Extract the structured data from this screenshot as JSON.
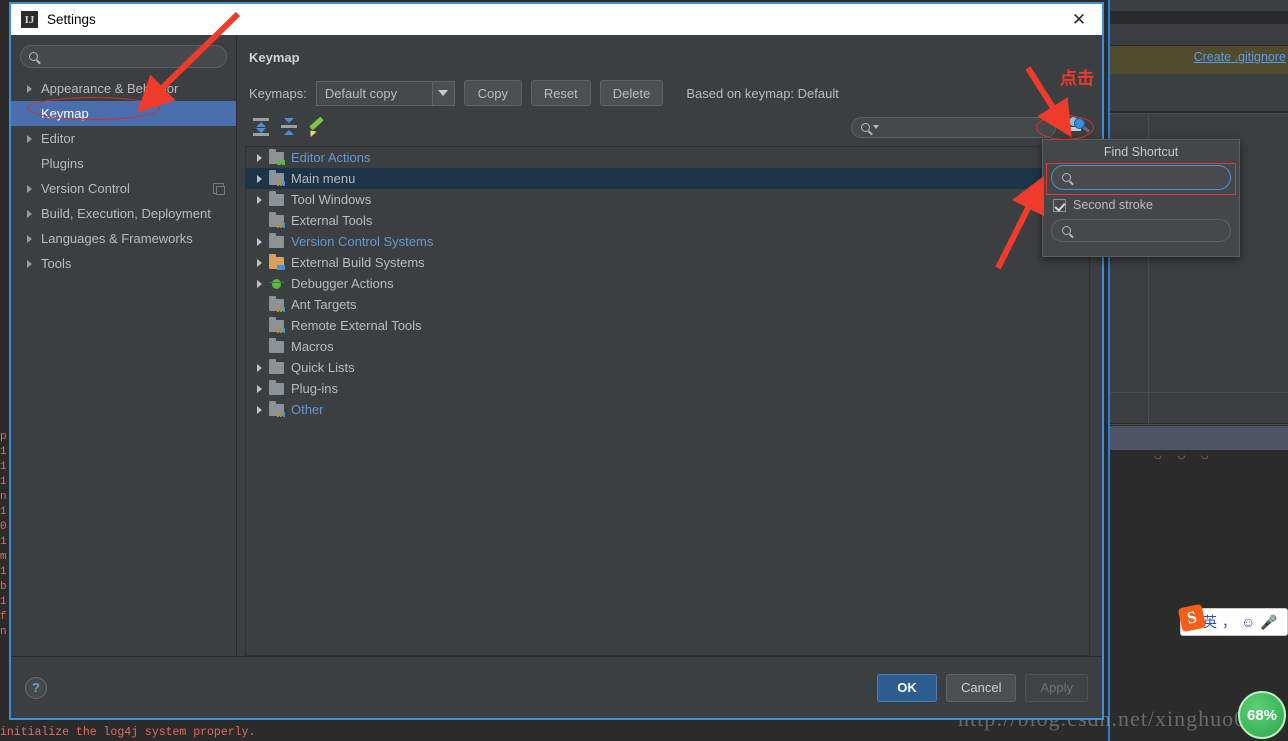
{
  "dialog": {
    "title": "Settings",
    "icon": "intellij-idea-icon",
    "close_label": "✕"
  },
  "sidebar": {
    "search": {
      "value": "",
      "placeholder": ""
    },
    "items": [
      {
        "label": "Appearance & Behavior",
        "expandable": true,
        "selected": false,
        "copy_icon": false
      },
      {
        "label": "Keymap",
        "expandable": false,
        "selected": true,
        "copy_icon": false
      },
      {
        "label": "Editor",
        "expandable": true,
        "selected": false,
        "copy_icon": false
      },
      {
        "label": "Plugins",
        "expandable": false,
        "selected": false,
        "copy_icon": false
      },
      {
        "label": "Version Control",
        "expandable": true,
        "selected": false,
        "copy_icon": true
      },
      {
        "label": "Build, Execution, Deployment",
        "expandable": true,
        "selected": false,
        "copy_icon": false
      },
      {
        "label": "Languages & Frameworks",
        "expandable": true,
        "selected": false,
        "copy_icon": false
      },
      {
        "label": "Tools",
        "expandable": true,
        "selected": false,
        "copy_icon": false
      }
    ]
  },
  "main": {
    "title": "Keymap",
    "keymaps_label": "Keymaps:",
    "keymap_selected": "Default copy",
    "buttons": {
      "copy": "Copy",
      "reset": "Reset",
      "delete": "Delete"
    },
    "based_on": "Based on keymap: Default",
    "shortcut_search": {
      "value": "",
      "placeholder": ""
    },
    "tools": {
      "expand_all": "expand-all-icon",
      "collapse_all": "collapse-all-icon",
      "edit_shortcut": "edit-shortcut-icon",
      "find_shortcut": "find-shortcut-icon"
    },
    "tree": [
      {
        "label": "Editor Actions",
        "expandable": true,
        "link": true,
        "selected": false,
        "icon": "folder-green"
      },
      {
        "label": "Main menu",
        "expandable": true,
        "link": false,
        "selected": true,
        "icon": "folder-multi"
      },
      {
        "label": "Tool Windows",
        "expandable": true,
        "link": false,
        "selected": false,
        "icon": "folder"
      },
      {
        "label": "External Tools",
        "expandable": false,
        "link": false,
        "selected": false,
        "icon": "folder-multi"
      },
      {
        "label": "Version Control Systems",
        "expandable": true,
        "link": true,
        "selected": false,
        "icon": "folder"
      },
      {
        "label": "External Build Systems",
        "expandable": true,
        "link": false,
        "selected": false,
        "icon": "folder-orange"
      },
      {
        "label": "Debugger Actions",
        "expandable": true,
        "link": false,
        "selected": false,
        "icon": "bug"
      },
      {
        "label": "Ant Targets",
        "expandable": false,
        "link": false,
        "selected": false,
        "icon": "folder-multi"
      },
      {
        "label": "Remote External Tools",
        "expandable": false,
        "link": false,
        "selected": false,
        "icon": "folder-multi"
      },
      {
        "label": "Macros",
        "expandable": false,
        "link": false,
        "selected": false,
        "icon": "folder"
      },
      {
        "label": "Quick Lists",
        "expandable": true,
        "link": false,
        "selected": false,
        "icon": "folder"
      },
      {
        "label": "Plug-ins",
        "expandable": true,
        "link": false,
        "selected": false,
        "icon": "folder"
      },
      {
        "label": "Other",
        "expandable": true,
        "link": true,
        "selected": false,
        "icon": "folder-multi"
      }
    ]
  },
  "footer": {
    "help": "?",
    "ok": "OK",
    "cancel": "Cancel",
    "apply": "Apply"
  },
  "find_shortcut_popup": {
    "title": "Find Shortcut",
    "first_stroke": {
      "value": "",
      "placeholder": ""
    },
    "second_stroke_label": "Second stroke",
    "second_stroke_checked": true,
    "second_stroke_input": {
      "value": "",
      "placeholder": ""
    }
  },
  "annotations": {
    "click_text": "点击",
    "arrow_color": "#ef3b2c",
    "ellipse_color": "#d93025",
    "redbox_color": "#e53935"
  },
  "background": {
    "gitignore_link": "Create .gitignore",
    "console_lines": [
      "p",
      "1",
      "1",
      "1",
      "n",
      "1",
      "0",
      "1",
      "m",
      "1",
      "b",
      "1",
      "f",
      "n"
    ],
    "console_bottom": "initialize the log4j system properly.",
    "watermark": "http://blog.csdn.net/xinghuo0",
    "ime": {
      "logo": "S",
      "lang": "英",
      "punct": "，",
      "emoji": "☺",
      "mic": "🎤"
    },
    "zoom_badge": "68%"
  }
}
